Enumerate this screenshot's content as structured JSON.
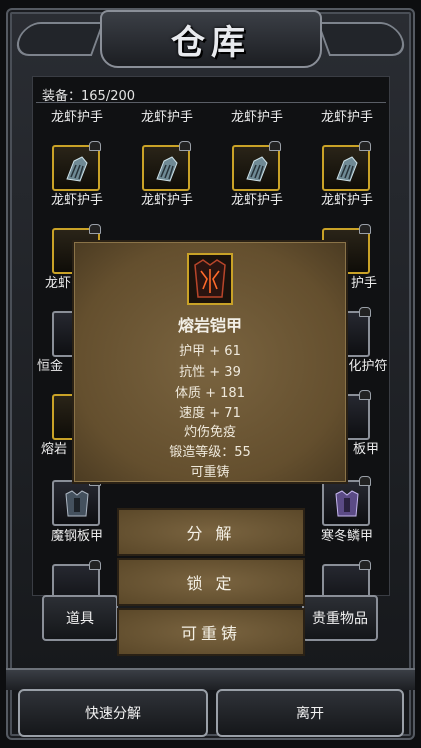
{
  "title": "仓库",
  "capacity": "装备：165/200",
  "grid": {
    "row0_labels": [
      "龙虾护手",
      "龙虾护手",
      "龙虾护手",
      "龙虾护手"
    ],
    "row1_labels": [
      "龙虾护手",
      "龙虾护手",
      "龙虾护手",
      "龙虾护手"
    ],
    "row2_left": "龙虾",
    "row2_right": "护手",
    "row3_left": "恒金",
    "row3_right": "化护符",
    "row4_left": "熔岩",
    "row4_right": "板甲",
    "row5_labels": [
      "魔钢板甲",
      "寒冬鳞甲"
    ]
  },
  "popup": {
    "item_name": "熔岩铠甲",
    "stats": [
      "护甲 + 61",
      "抗性 + 39",
      "体质 + 181",
      "速度 + 71",
      "灼伤免疫",
      "锻造等级：55",
      "可重铸"
    ]
  },
  "menu": {
    "decompose": "分 解",
    "lock": "锁 定",
    "reforge": "可重铸"
  },
  "tabs": {
    "items": "道具",
    "valuables": "贵重物品"
  },
  "bottom": {
    "quick_decompose": "快速分解",
    "leave": "离开"
  },
  "colors": {
    "gold_border": "#c9a227",
    "parchment": "#6e5a37"
  }
}
